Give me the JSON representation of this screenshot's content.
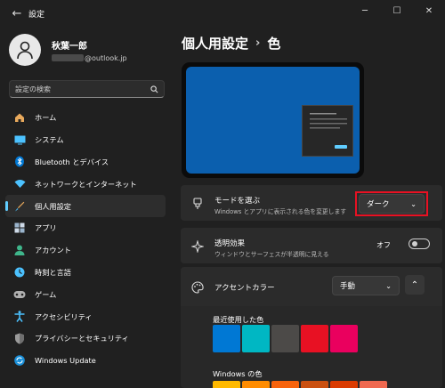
{
  "titlebar": {
    "back_icon": "back-arrow-icon",
    "title": "設定",
    "min_icon": "minimize-icon",
    "max_icon": "maximize-icon",
    "close_icon": "close-icon"
  },
  "profile": {
    "name": "秋葉一郎",
    "email_visible": "@outlook.jp"
  },
  "search": {
    "placeholder": "設定の検索",
    "icon": "search-icon"
  },
  "sidebar": {
    "items": [
      {
        "label": "ホーム",
        "icon": "home-icon",
        "color": "#e8a95c"
      },
      {
        "label": "システム",
        "icon": "system-icon",
        "color": "#4cc2ff"
      },
      {
        "label": "Bluetooth とデバイス",
        "icon": "bluetooth-icon",
        "color": "#0078d4"
      },
      {
        "label": "ネットワークとインターネット",
        "icon": "network-icon",
        "color": "#4cc2ff"
      },
      {
        "label": "個人用設定",
        "icon": "personalization-icon",
        "color": "#e8a95c",
        "active": true
      },
      {
        "label": "アプリ",
        "icon": "apps-icon",
        "color": "#9ab4cc"
      },
      {
        "label": "アカウント",
        "icon": "account-icon",
        "color": "#3fb68b"
      },
      {
        "label": "時刻と言語",
        "icon": "time-language-icon",
        "color": "#4cc2ff"
      },
      {
        "label": "ゲーム",
        "icon": "gaming-icon",
        "color": "#b0b0b0"
      },
      {
        "label": "アクセシビリティ",
        "icon": "accessibility-icon",
        "color": "#4cc2ff"
      },
      {
        "label": "プライバシーとセキュリティ",
        "icon": "privacy-shield-icon",
        "color": "#9a9a9a"
      },
      {
        "label": "Windows Update",
        "icon": "windows-update-icon",
        "color": "#4cc2ff"
      }
    ]
  },
  "main": {
    "breadcrumb_parent": "個人用設定",
    "breadcrumb_sep": "›",
    "breadcrumb_current": "色",
    "mode": {
      "title": "モードを選ぶ",
      "subtitle": "Windows とアプリに表示される色を変更します",
      "value": "ダーク",
      "icon": "brush-icon"
    },
    "transparency": {
      "title": "透明効果",
      "subtitle": "ウィンドウとサーフェスが半透明に見える",
      "state": "オフ",
      "icon": "transparency-icon"
    },
    "accent": {
      "title": "アクセントカラー",
      "value": "手動",
      "icon": "palette-icon"
    },
    "recent_label": "最近使用した色",
    "recent_colors": [
      "#0078d4",
      "#00b7c3",
      "#4c4a48",
      "#e81123",
      "#ea005e"
    ],
    "windows_label": "Windows の色",
    "windows_colors": [
      "#ffb900",
      "#ff8c00",
      "#f7630c",
      "#ca5010",
      "#da3b01",
      "#ef6950"
    ]
  },
  "colors": {
    "accent": "#60cdff",
    "highlight_box": "#e81123",
    "preview_bg": "#0b5fae"
  }
}
